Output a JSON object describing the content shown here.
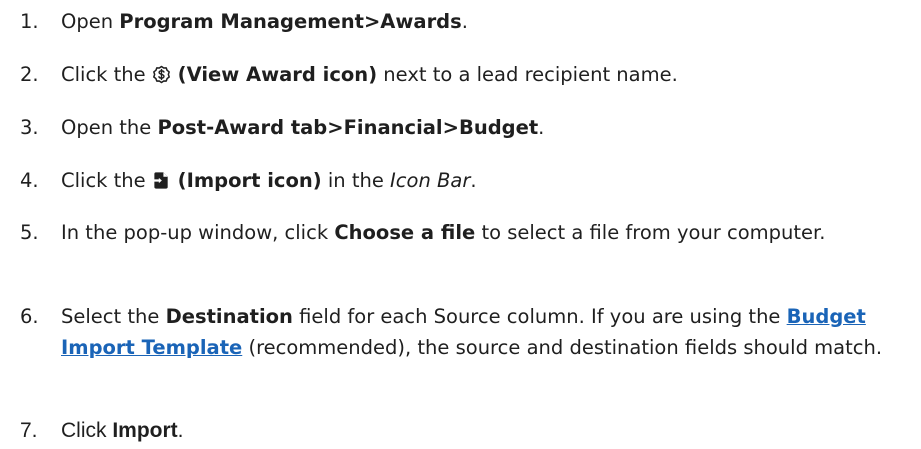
{
  "steps": [
    {
      "number": "1.",
      "parts": [
        {
          "text": "Open "
        },
        {
          "bold": "Program Management>Awards"
        },
        {
          "text": "."
        }
      ]
    },
    {
      "number": "2.",
      "parts": [
        {
          "text": "Click the "
        },
        {
          "icon": "dollar-circle-icon"
        },
        {
          "bold": " (View Award icon)"
        },
        {
          "text": " next to a lead recipient name."
        }
      ]
    },
    {
      "number": "3.",
      "parts": [
        {
          "text": "Open the "
        },
        {
          "bold": "Post-Award tab>Financial>Budget"
        },
        {
          "text": "."
        }
      ]
    },
    {
      "number": "4.",
      "parts": [
        {
          "text": "Click the "
        },
        {
          "icon": "file-import-icon"
        },
        {
          "bold": " (Import icon)"
        },
        {
          "text": " in the "
        },
        {
          "italic": "Icon Bar"
        },
        {
          "text": "."
        }
      ]
    },
    {
      "number": "5.",
      "parts": [
        {
          "text": "In the pop-up window, click "
        },
        {
          "bold": "Choose a file"
        },
        {
          "text": " to select a file from your computer."
        }
      ]
    },
    {
      "number": "6.",
      "parts": [
        {
          "text": "Select the "
        },
        {
          "bold": "Destination"
        },
        {
          "text": " field for each Source column. If you are using the "
        },
        {
          "link": "Budget Import Template"
        },
        {
          "text": " (recommended), the source and destination fields should match."
        }
      ]
    },
    {
      "number": "7.",
      "parts": [
        {
          "text": "Click "
        },
        {
          "bold": "Import"
        },
        {
          "text": "."
        }
      ]
    }
  ]
}
